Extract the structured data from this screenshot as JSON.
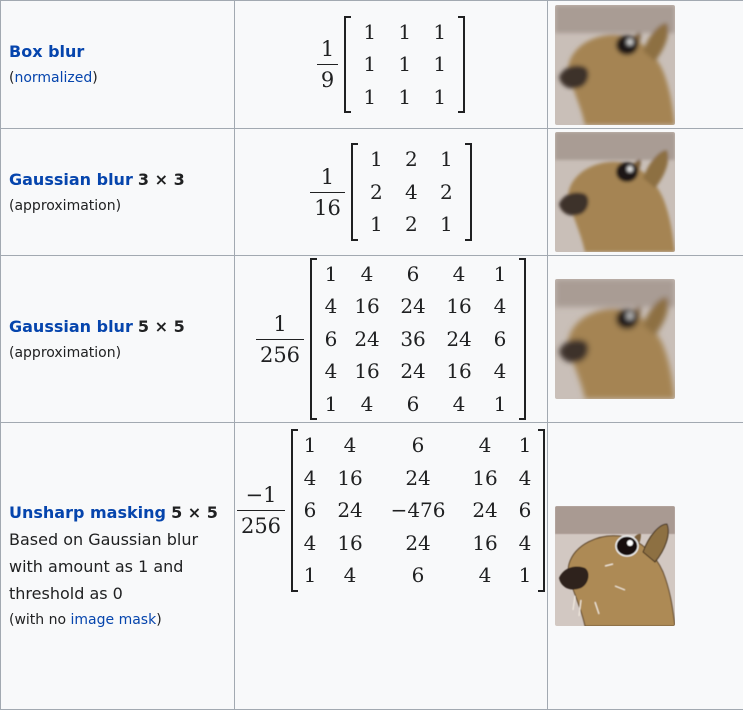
{
  "rows": [
    {
      "name": "Box blur",
      "dims": "",
      "note_open": "(",
      "note_link": "normalized",
      "note_text": "",
      "note_close": ")",
      "factor_num": "1",
      "factor_den": "9",
      "matrix": [
        [
          "1",
          "1",
          "1"
        ],
        [
          "1",
          "1",
          "1"
        ],
        [
          "1",
          "1",
          "1"
        ]
      ]
    },
    {
      "name": "Gaussian blur",
      "dims": "3 × 3",
      "note_text": "(approximation)",
      "factor_num": "1",
      "factor_den": "16",
      "matrix": [
        [
          "1",
          "2",
          "1"
        ],
        [
          "2",
          "4",
          "2"
        ],
        [
          "1",
          "2",
          "1"
        ]
      ]
    },
    {
      "name": "Gaussian blur",
      "dims": "5 × 5",
      "note_text": "(approximation)",
      "factor_num": "1",
      "factor_den": "256",
      "matrix": [
        [
          "1",
          "4",
          "6",
          "4",
          "1"
        ],
        [
          "4",
          "16",
          "24",
          "16",
          "4"
        ],
        [
          "6",
          "24",
          "36",
          "24",
          "6"
        ],
        [
          "4",
          "16",
          "24",
          "16",
          "4"
        ],
        [
          "1",
          "4",
          "6",
          "4",
          "1"
        ]
      ]
    },
    {
      "name": "Unsharp masking",
      "dims": "5 × 5",
      "desc_lines": [
        "Based on Gaussian blur",
        "with amount as 1 and",
        "threshold as 0"
      ],
      "note_open": "(with no ",
      "note_link": "image mask",
      "note_close": ")",
      "factor_num": "−1",
      "factor_den": "256",
      "matrix": [
        [
          "1",
          "4",
          "6",
          "4",
          "1"
        ],
        [
          "4",
          "16",
          "24",
          "16",
          "4"
        ],
        [
          "6",
          "24",
          "−476",
          "24",
          "6"
        ],
        [
          "4",
          "16",
          "24",
          "16",
          "4"
        ],
        [
          "1",
          "4",
          "6",
          "4",
          "1"
        ]
      ]
    }
  ]
}
